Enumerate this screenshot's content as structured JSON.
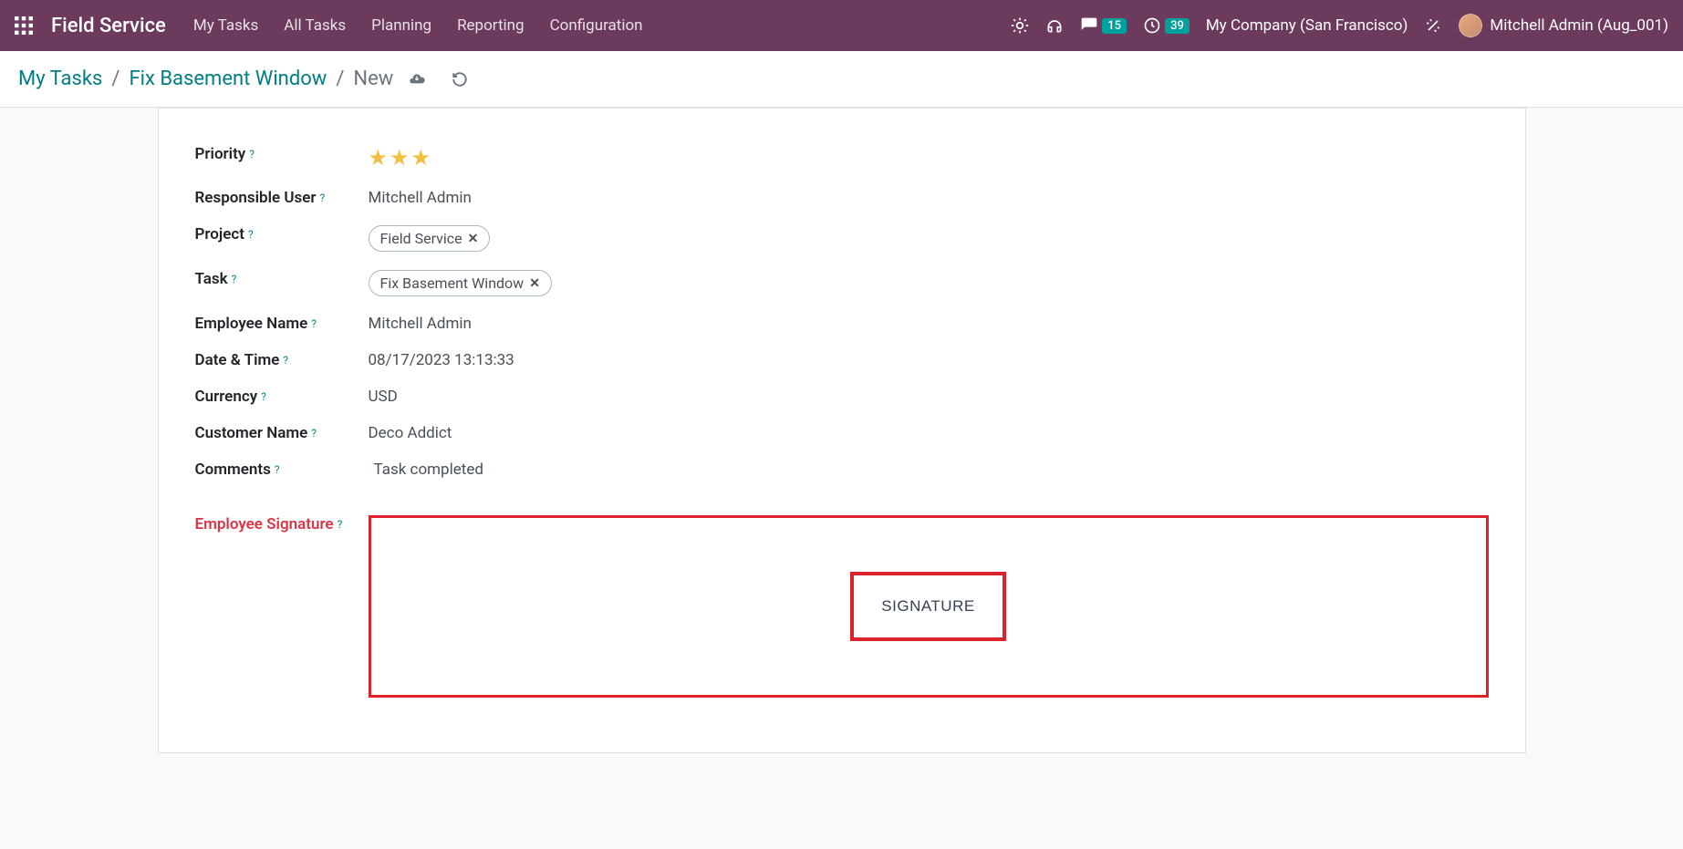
{
  "navbar": {
    "brand": "Field Service",
    "links": [
      "My Tasks",
      "All Tasks",
      "Planning",
      "Reporting",
      "Configuration"
    ],
    "messages_badge": "15",
    "activities_badge": "39",
    "company": "My Company (San Francisco)",
    "user": "Mitchell Admin (Aug_001)"
  },
  "breadcrumb": {
    "root": "My Tasks",
    "parent": "Fix Basement Window",
    "current": "New"
  },
  "form": {
    "priority": {
      "label": "Priority",
      "stars": 3
    },
    "responsible_user": {
      "label": "Responsible User",
      "value": "Mitchell Admin"
    },
    "project": {
      "label": "Project",
      "tag": "Field Service"
    },
    "task": {
      "label": "Task",
      "tag": "Fix Basement Window"
    },
    "employee_name": {
      "label": "Employee Name",
      "value": "Mitchell Admin"
    },
    "datetime": {
      "label": "Date & Time",
      "value": "08/17/2023 13:13:33"
    },
    "currency": {
      "label": "Currency",
      "value": "USD"
    },
    "customer_name": {
      "label": "Customer Name",
      "value": "Deco Addict"
    },
    "comments": {
      "label": "Comments",
      "value": "Task completed"
    },
    "signature": {
      "label": "Employee Signature",
      "button": "SIGNATURE"
    }
  },
  "help_marker": "?"
}
